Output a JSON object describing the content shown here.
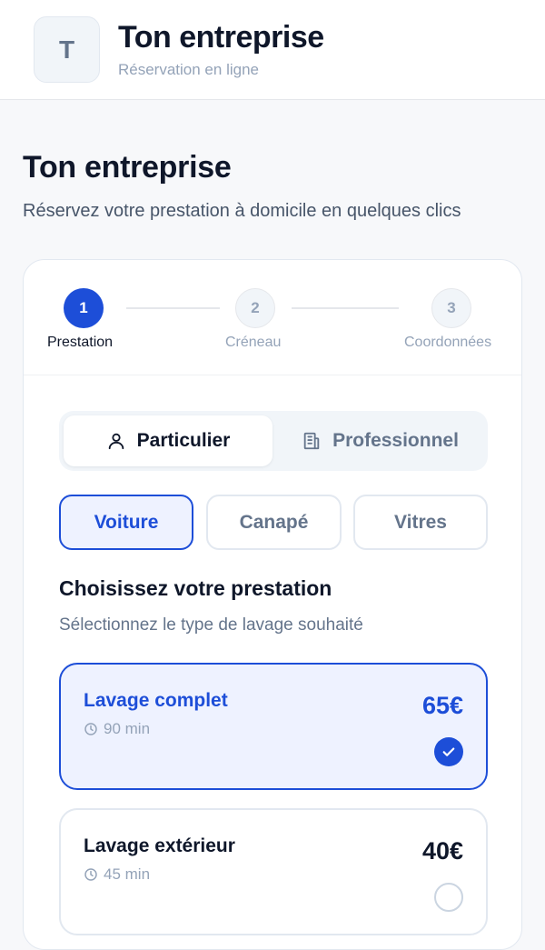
{
  "header": {
    "logo_letter": "T",
    "brand_name": "Ton entreprise",
    "brand_subtitle": "Réservation en ligne"
  },
  "hero": {
    "title": "Ton entreprise",
    "subtitle": "Réservez votre prestation à domicile en quelques clics"
  },
  "stepper": {
    "current_step": 1,
    "steps": [
      {
        "number": "1",
        "label": "Prestation"
      },
      {
        "number": "2",
        "label": "Créneau"
      },
      {
        "number": "3",
        "label": "Coordonnées"
      }
    ]
  },
  "customer_type": {
    "selected": "Particulier",
    "options": [
      {
        "label": "Particulier",
        "icon": "user-icon"
      },
      {
        "label": "Professionnel",
        "icon": "building-icon"
      }
    ]
  },
  "service_types": {
    "selected": "Voiture",
    "options": [
      "Voiture",
      "Canapé",
      "Vitres"
    ]
  },
  "section": {
    "title": "Choisissez votre prestation",
    "subtitle": "Sélectionnez le type de lavage souhaité"
  },
  "prestations": [
    {
      "name": "Lavage complet",
      "duration": "90 min",
      "price": "65€",
      "selected": true
    },
    {
      "name": "Lavage extérieur",
      "duration": "45 min",
      "price": "40€",
      "selected": false
    }
  ],
  "colors": {
    "accent": "#1d4ed8",
    "accent_bg": "#eef2ff",
    "muted": "#94a3b8",
    "text": "#0f172a"
  }
}
